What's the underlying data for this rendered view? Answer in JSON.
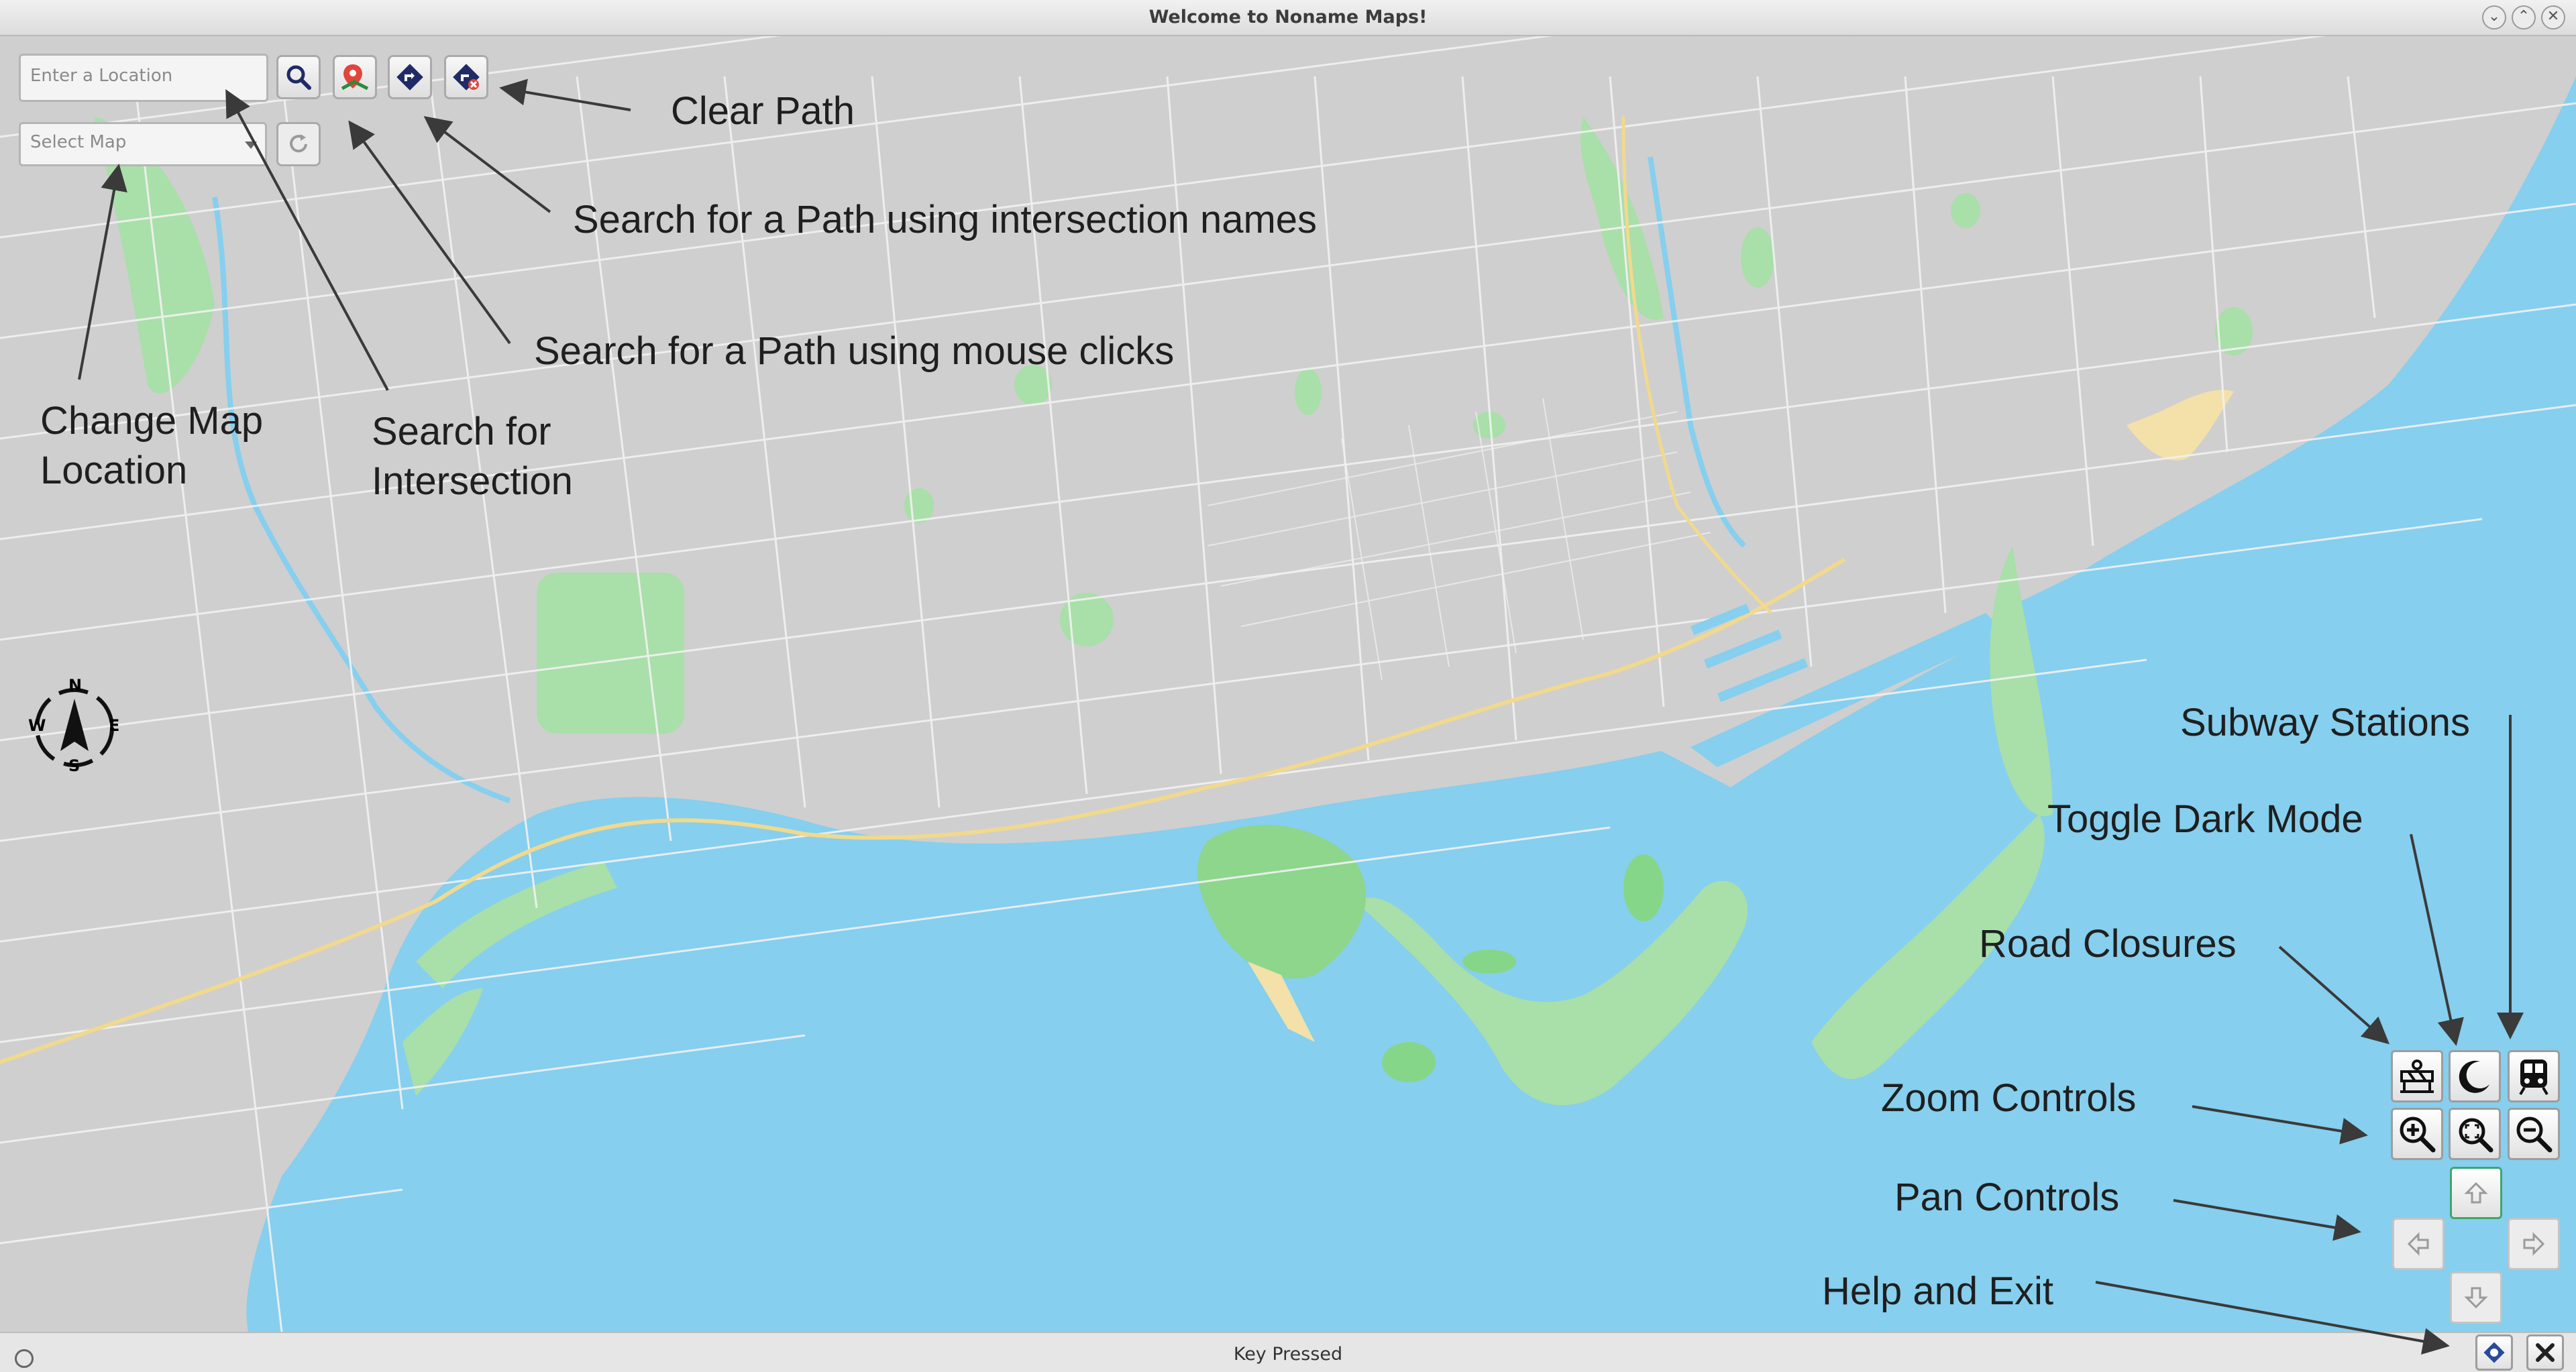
{
  "window": {
    "title": "Welcome to Noname Maps!",
    "buttons": [
      "minimize-icon",
      "maximize-icon",
      "close-icon"
    ]
  },
  "search": {
    "location_placeholder": "Enter a Location",
    "map_select_value": "Select Map"
  },
  "toolbar": {
    "icons": [
      "search-icon",
      "path-by-clicks-icon",
      "path-by-names-icon",
      "clear-path-icon",
      "refresh-icon"
    ]
  },
  "compass": {
    "letters": {
      "north": "N",
      "south": "S",
      "east": "E",
      "west": "W"
    }
  },
  "controls": {
    "icons": [
      "road-closures-icon",
      "dark-mode-icon",
      "subway-icon",
      "zoom-in-icon",
      "zoom-fit-icon",
      "zoom-out-icon",
      "pan-up-icon",
      "pan-left-icon",
      "pan-right-icon",
      "pan-down-icon",
      "help-icon",
      "exit-icon"
    ]
  },
  "annotations": {
    "clear_path": "Clear Path",
    "search_path_names": "Search for a Path using intersection names",
    "search_path_clicks": "Search for a Path using mouse clicks",
    "change_map_line1": "Change Map",
    "change_map_line2": "Location",
    "search_intersection_line1": "Search for",
    "search_intersection_line2": "Intersection",
    "subway_stations": "Subway Stations",
    "toggle_dark_mode": "Toggle Dark Mode",
    "road_closures": "Road Closures",
    "zoom_controls": "Zoom Controls",
    "pan_controls": "Pan Controls",
    "help_and_exit": "Help and Exit"
  },
  "status": {
    "text": "Key Pressed"
  },
  "colors": {
    "land": "#cfcfcf",
    "water": "#86cfee",
    "park": "#9fdca4",
    "park_dark": "#86d68a",
    "beach": "#f3e1a9",
    "highway": "#f1d98d",
    "road": "#f4f4f4"
  }
}
